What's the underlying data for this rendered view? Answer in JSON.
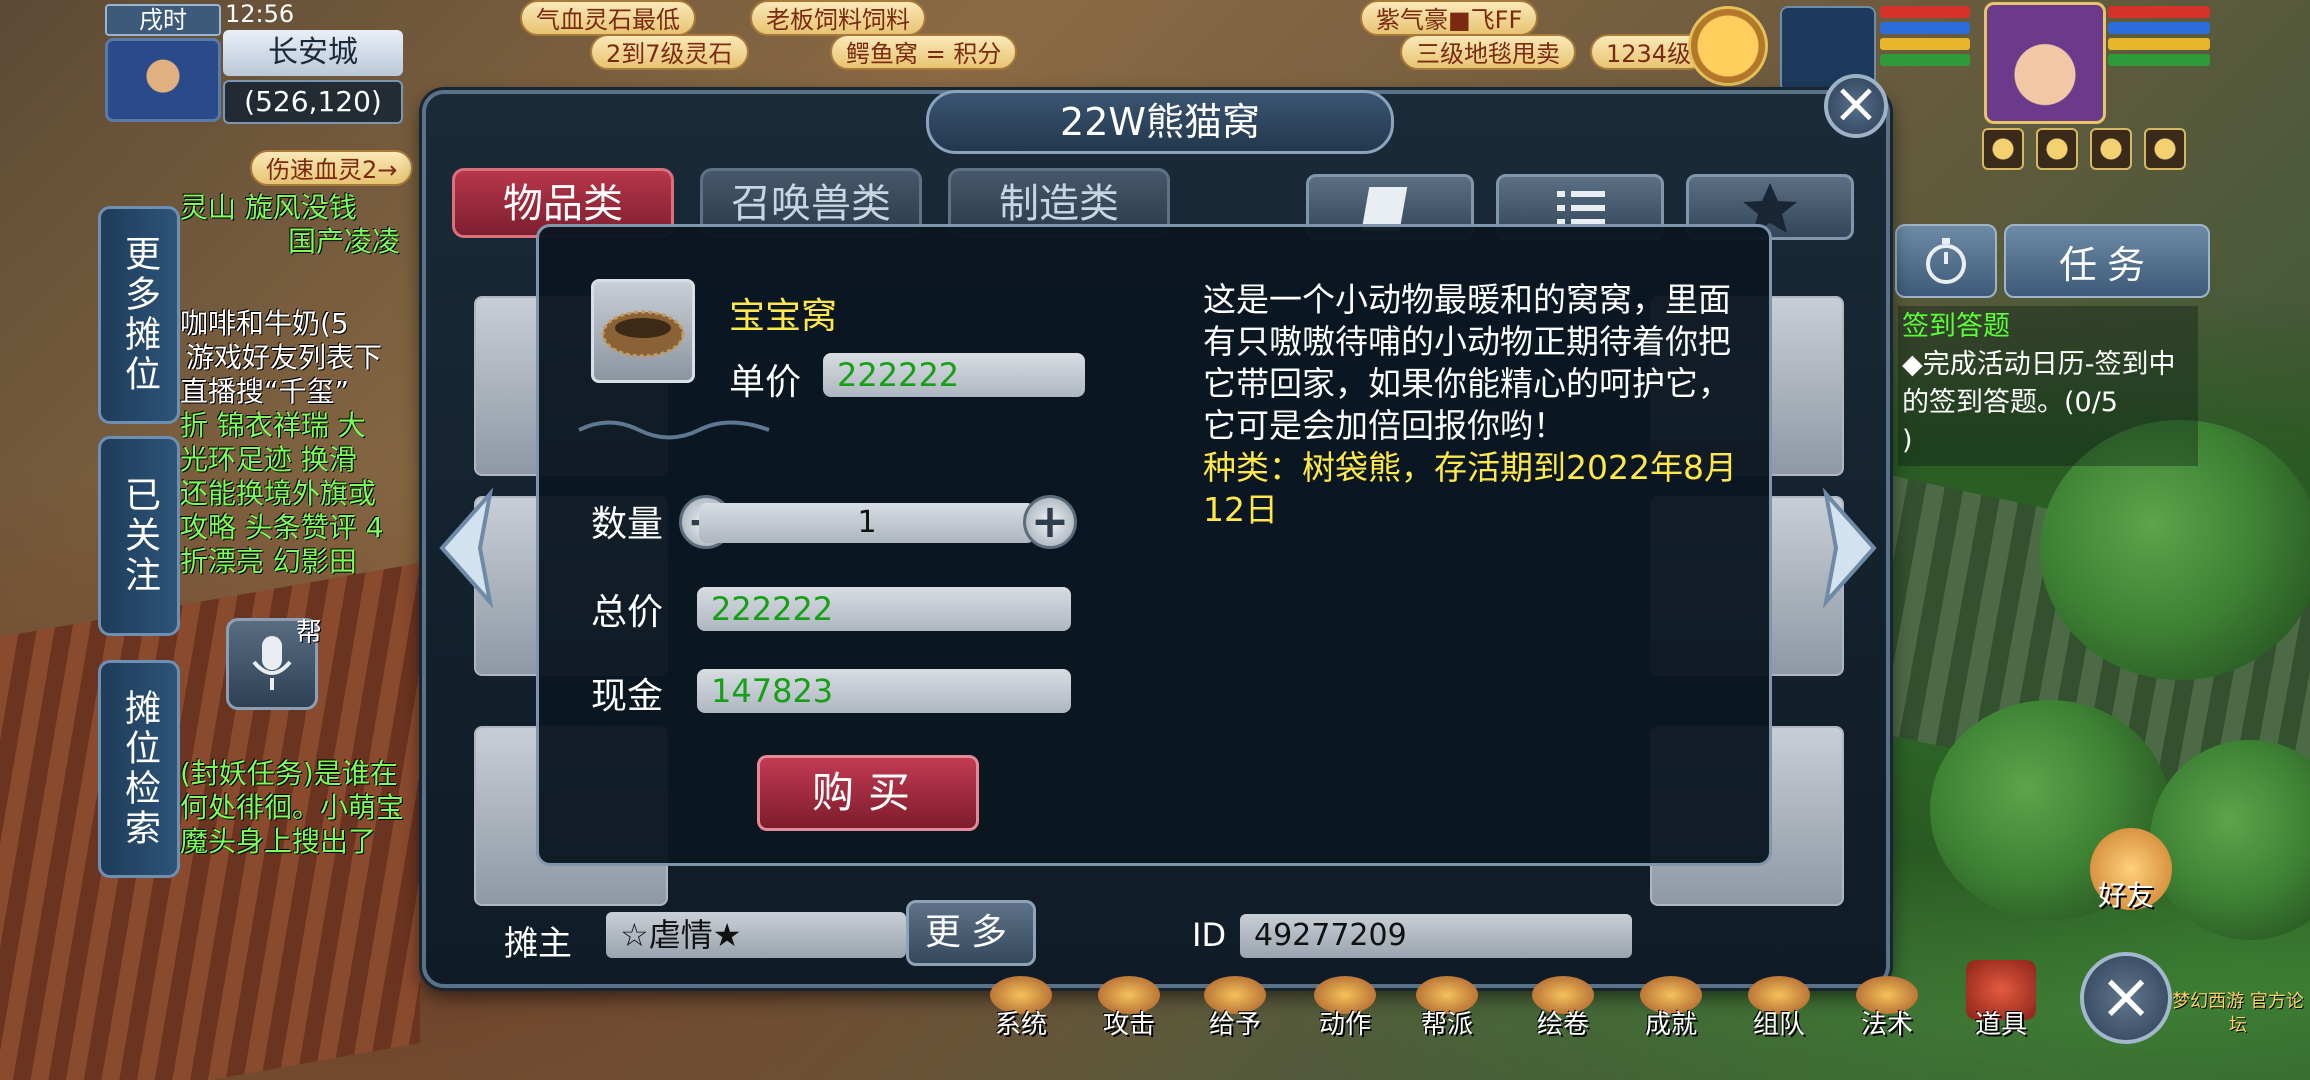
{
  "location": {
    "period": "戌时",
    "clock": "12:56",
    "city": "长安城",
    "coord": "(526,120)"
  },
  "bubbles": [
    "气血灵石最低",
    "老板饲料饲料",
    "2到7级灵石",
    "鳄鱼窝 = 积分",
    "伤速血灵2→",
    "紫气豪■飞FF",
    "三级地毯甩卖",
    "1234级"
  ],
  "chat_lines": [
    {
      "text": "灵山 旋风没钱",
      "color": "#7cff5a"
    },
    {
      "text": "国产凌凌",
      "color": "#7cff5a"
    },
    {
      "text": "咖啡和牛奶(5",
      "color": "#ffffff"
    },
    {
      "text": "游戏好友列表下",
      "color": "#ffffff"
    },
    {
      "text": "直播搜“千玺”",
      "color": "#ffffff"
    },
    {
      "text": "折 锦衣祥瑞 大",
      "color": "#7cff5a"
    },
    {
      "text": "光环足迹  换滑",
      "color": "#7cff5a"
    },
    {
      "text": "还能换境外旗或",
      "color": "#7cff5a"
    },
    {
      "text": "攻略 头条赞评 4",
      "color": "#7cff5a"
    },
    {
      "text": "折漂亮 幻影田",
      "color": "#7cff5a"
    },
    {
      "text": "(封妖任务)是谁在",
      "color": "#7cff5a"
    },
    {
      "text": "何处徘徊。小萌宝",
      "color": "#7cff5a"
    },
    {
      "text": "魔头身上搜出了",
      "color": "#7cff5a"
    }
  ],
  "side_tabs": [
    "更多摊位",
    "已关注",
    "摊位检索"
  ],
  "voice_label": "帮",
  "dialog": {
    "title": "22W熊猫窝",
    "close": "×",
    "categories": [
      "物品类",
      "召唤兽类",
      "制造类"
    ]
  },
  "item": {
    "name": "宝宝窝",
    "unit_price_label": "单价",
    "unit_price": "222222",
    "qty_label": "数量",
    "qty": "1",
    "total_label": "总价",
    "total": "222222",
    "cash_label": "现金",
    "cash": "147823",
    "buy": "购买",
    "description": "这是一个小动物最暖和的窝窝，里面有只嗷嗷待哺的小动物正期待着你把它带回家，如果你能精心的呵护它，它可是会加倍回报你哟！",
    "meta": "种类：树袋熊，存活期到2022年8月12日"
  },
  "owner": {
    "label": "摊主",
    "name": "☆虐情★",
    "more": "更多",
    "id_label": "ID",
    "id": "49277209"
  },
  "right_panel": {
    "task_button": "任务",
    "task_title": "签到答题",
    "task_detail": "◆完成活动日历-签到中的签到答题。",
    "task_progress": "(0/5",
    "task_tail": ")"
  },
  "bottom_menu": [
    "系统",
    "攻击",
    "给予",
    "动作",
    "帮派",
    "绘卷",
    "成就",
    "组队",
    "法术",
    "道具"
  ],
  "friend_label": "好友",
  "logo_text": "梦幻西游 官方论坛"
}
